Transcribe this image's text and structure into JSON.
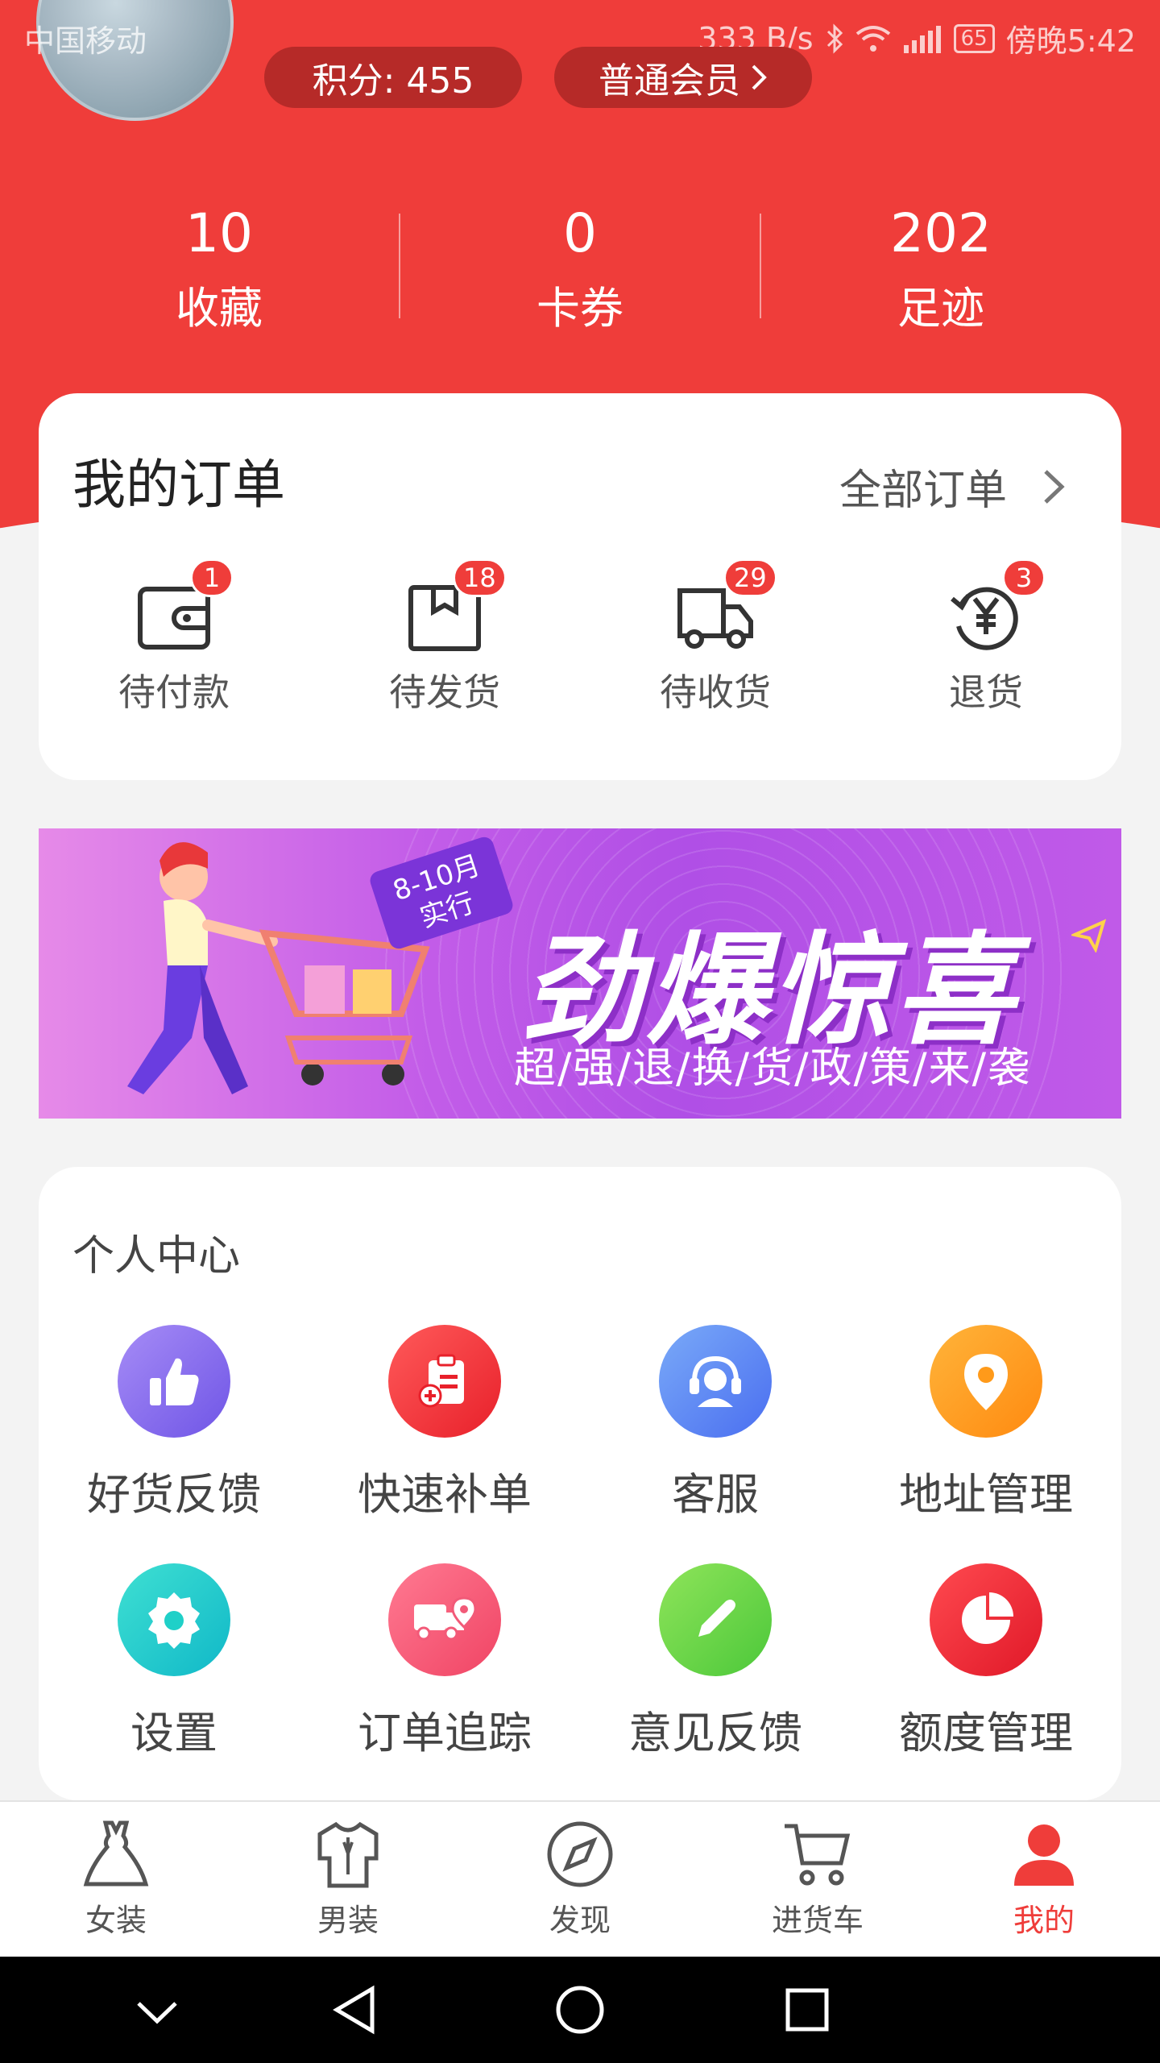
{
  "status_bar": {
    "carrier": "中国移动",
    "speed": "333 B/s",
    "battery": "65",
    "time": "傍晚5:42"
  },
  "header": {
    "points_label": "积分: 455",
    "member_label": "普通会员",
    "stats": [
      {
        "num": "10",
        "label": "收藏"
      },
      {
        "num": "0",
        "label": "卡券"
      },
      {
        "num": "202",
        "label": "足迹"
      }
    ]
  },
  "orders": {
    "title": "我的订单",
    "all_label": "全部订单",
    "items": [
      {
        "label": "待付款",
        "badge": "1",
        "icon": "wallet-icon"
      },
      {
        "label": "待发货",
        "badge": "18",
        "icon": "box-icon"
      },
      {
        "label": "待收货",
        "badge": "29",
        "icon": "truck-icon"
      },
      {
        "label": "退货",
        "badge": "3",
        "icon": "yen-return-icon"
      }
    ]
  },
  "banner": {
    "tag_line1": "8-10月",
    "tag_line2": "实行",
    "title": "劲爆惊喜",
    "subtitle": "超/强/退/换/货/政/策/来/袭"
  },
  "personal_center": {
    "title": "个人中心",
    "items": [
      {
        "label": "好货反馈",
        "icon": "thumbs-up-icon",
        "color": "#8a6df0"
      },
      {
        "label": "快速补单",
        "icon": "clipboard-plus-icon",
        "color": "#f23a3a"
      },
      {
        "label": "客服",
        "icon": "headset-icon",
        "color": "#5a8ef5"
      },
      {
        "label": "地址管理",
        "icon": "location-pin-icon",
        "color": "#ff9a1a"
      },
      {
        "label": "设置",
        "icon": "gear-icon",
        "color": "#1fd0c8"
      },
      {
        "label": "订单追踪",
        "icon": "truck-pin-icon",
        "color": "#f25a78"
      },
      {
        "label": "意见反馈",
        "icon": "pencil-icon",
        "color": "#6cd44a"
      },
      {
        "label": "额度管理",
        "icon": "pie-chart-icon",
        "color": "#f2323a"
      }
    ]
  },
  "tabbar": {
    "tabs": [
      {
        "label": "女装",
        "icon": "dress-icon"
      },
      {
        "label": "男装",
        "icon": "shirt-icon"
      },
      {
        "label": "发现",
        "icon": "compass-icon"
      },
      {
        "label": "进货车",
        "icon": "cart-icon"
      },
      {
        "label": "我的",
        "icon": "user-icon"
      }
    ],
    "active_color": "#ef3d3a"
  },
  "colors": {
    "brand_red": "#ef3d3a",
    "pill_bg": "#b62a28",
    "background": "#f3f3f3"
  }
}
